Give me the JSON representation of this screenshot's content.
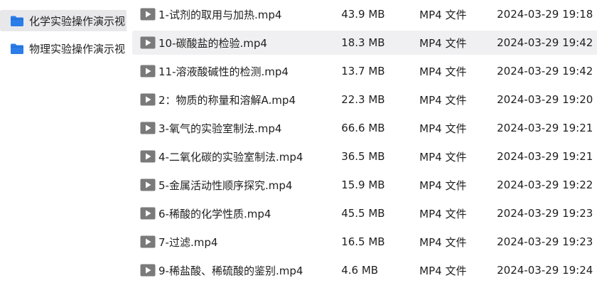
{
  "sidebar": {
    "folders": [
      {
        "label": "化学实验操作演示视",
        "icon": "folder-icon",
        "selected": true
      },
      {
        "label": "物理实验操作演示视",
        "icon": "folder-icon",
        "selected": false
      }
    ]
  },
  "files": [
    {
      "name": "1-试剂的取用与加热.mp4",
      "size": "43.9 MB",
      "type": "MP4 文件",
      "modified": "2024-03-29 19:18",
      "icon": "video-play-icon"
    },
    {
      "name": "10-碳酸盐的检验.mp4",
      "size": "18.3 MB",
      "type": "MP4 文件",
      "modified": "2024-03-29 19:42",
      "icon": "video-play-icon"
    },
    {
      "name": "11-溶液酸碱性的检测.mp4",
      "size": "13.7 MB",
      "type": "MP4 文件",
      "modified": "2024-03-29 19:42",
      "icon": "video-play-icon"
    },
    {
      "name": "2：物质的称量和溶解A.mp4",
      "size": "22.3 MB",
      "type": "MP4 文件",
      "modified": "2024-03-29 19:20",
      "icon": "video-play-icon"
    },
    {
      "name": "3-氧气的实验室制法.mp4",
      "size": "66.6 MB",
      "type": "MP4 文件",
      "modified": "2024-03-29 19:21",
      "icon": "video-play-icon"
    },
    {
      "name": "4-二氧化碳的实验室制法.mp4",
      "size": "36.5 MB",
      "type": "MP4 文件",
      "modified": "2024-03-29 19:21",
      "icon": "video-play-icon"
    },
    {
      "name": "5-金属活动性顺序探究.mp4",
      "size": "15.9 MB",
      "type": "MP4 文件",
      "modified": "2024-03-29 19:22",
      "icon": "video-play-icon"
    },
    {
      "name": "6-稀酸的化学性质.mp4",
      "size": "45.5 MB",
      "type": "MP4 文件",
      "modified": "2024-03-29 19:23",
      "icon": "video-play-icon"
    },
    {
      "name": "7-过滤.mp4",
      "size": "16.5 MB",
      "type": "MP4 文件",
      "modified": "2024-03-29 19:23",
      "icon": "video-play-icon"
    },
    {
      "name": "9-稀盐酸、稀硫酸的鉴别.mp4",
      "size": "4.6 MB",
      "type": "MP4 文件",
      "modified": "2024-03-29 19:24",
      "icon": "video-play-icon"
    }
  ],
  "colors": {
    "folder_blue": "#2b7de9",
    "play_gray": "#7a7a7a",
    "selected_bg": "#e8e8eb",
    "hover_bg": "#f0f0f2"
  }
}
